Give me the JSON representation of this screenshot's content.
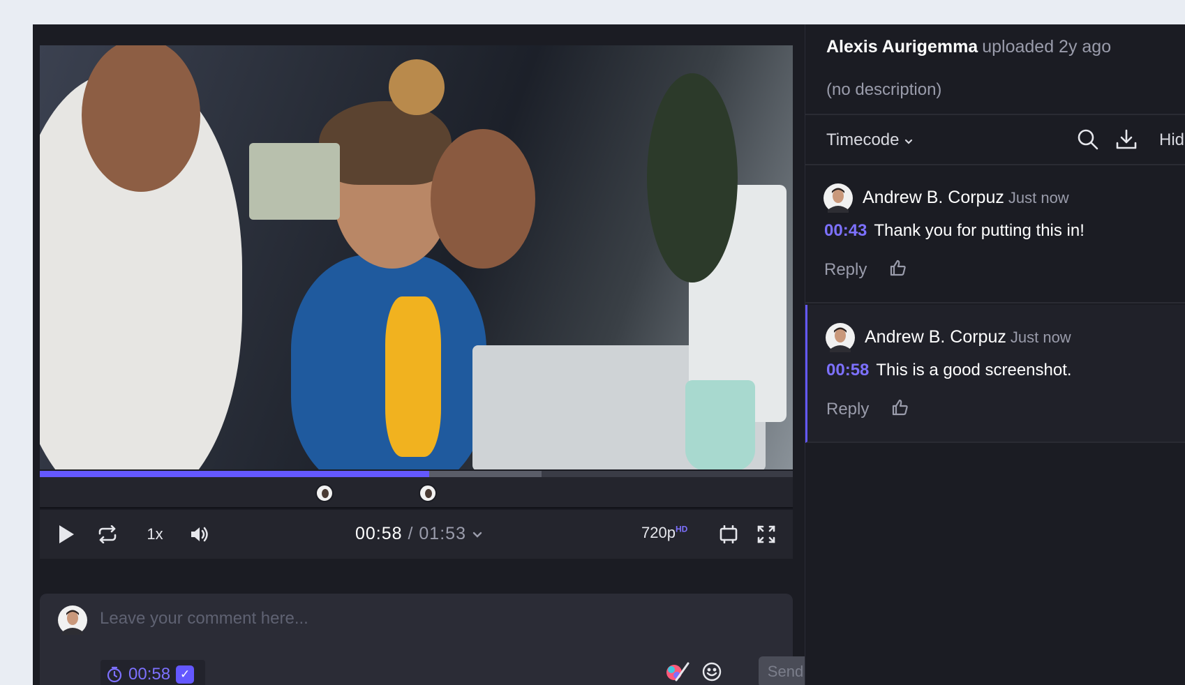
{
  "uploader": {
    "name": "Alexis Aurigemma",
    "meta": "uploaded 2y ago",
    "description": "(no description)"
  },
  "toolbar": {
    "sort_label": "Timecode",
    "hide_label": "Hide",
    "search_icon": "search-icon",
    "download_icon": "download-icon"
  },
  "player": {
    "current_time": "00:58",
    "duration": "01:53",
    "speed": "1x",
    "quality": "720p",
    "quality_badge": "HD",
    "progress_fraction": 0.517,
    "buffer_fraction": 0.666,
    "marker_times": [
      "00:43",
      "00:58"
    ]
  },
  "comments": [
    {
      "author": "Andrew B. Corpuz",
      "when": "Just now",
      "timestamp": "00:43",
      "text": "Thank you for putting this in!",
      "reply_label": "Reply",
      "active": false
    },
    {
      "author": "Andrew B. Corpuz",
      "when": "Just now",
      "timestamp": "00:58",
      "text": "This is a good screenshot.",
      "reply_label": "Reply",
      "active": true
    }
  ],
  "composer": {
    "placeholder": "Leave your comment here...",
    "timecode": "00:58",
    "send_label": "Send"
  },
  "colors": {
    "accent": "#6458ff",
    "panel": "#1b1c23"
  }
}
